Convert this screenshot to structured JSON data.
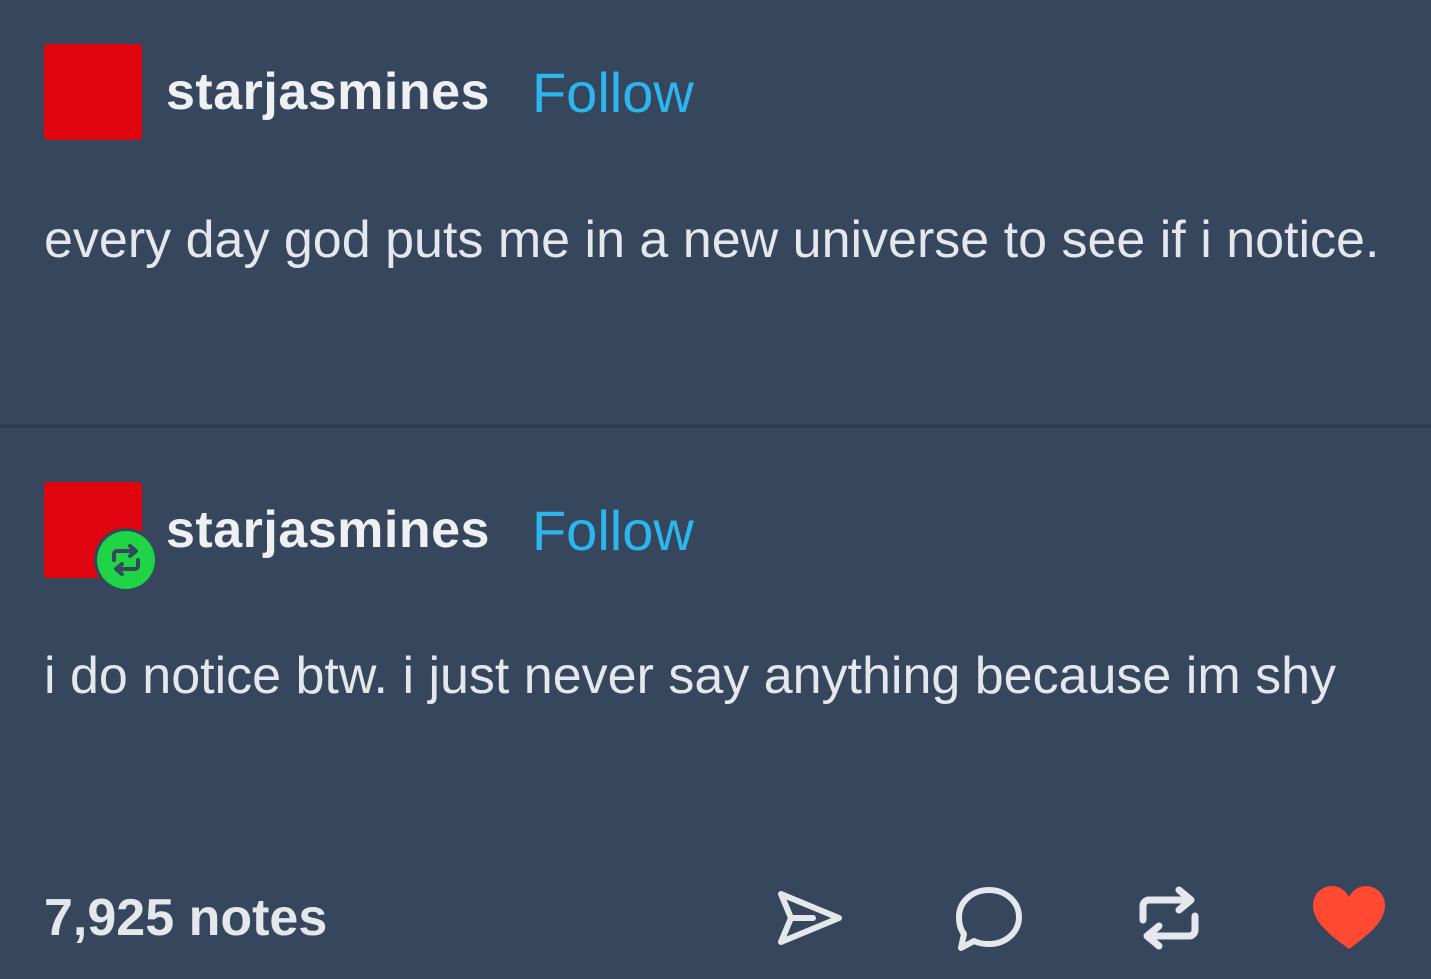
{
  "posts": [
    {
      "username": "starjasmines",
      "follow_label": "Follow",
      "text": "every day god puts me in a new universe to see if i notice."
    },
    {
      "username": "starjasmines",
      "follow_label": "Follow",
      "text": "i do notice btw. i just never say anything because im shy"
    }
  ],
  "footer": {
    "notes": "7,925 notes",
    "actions": [
      "share-icon",
      "reply-icon",
      "reblog-icon",
      "like-heart-icon"
    ]
  },
  "colors": {
    "background": "#36465d",
    "avatar": "#e0050e",
    "follow_link": "#2bb6ee",
    "reblog_badge": "#1fd445",
    "liked_heart": "#ff4930"
  }
}
